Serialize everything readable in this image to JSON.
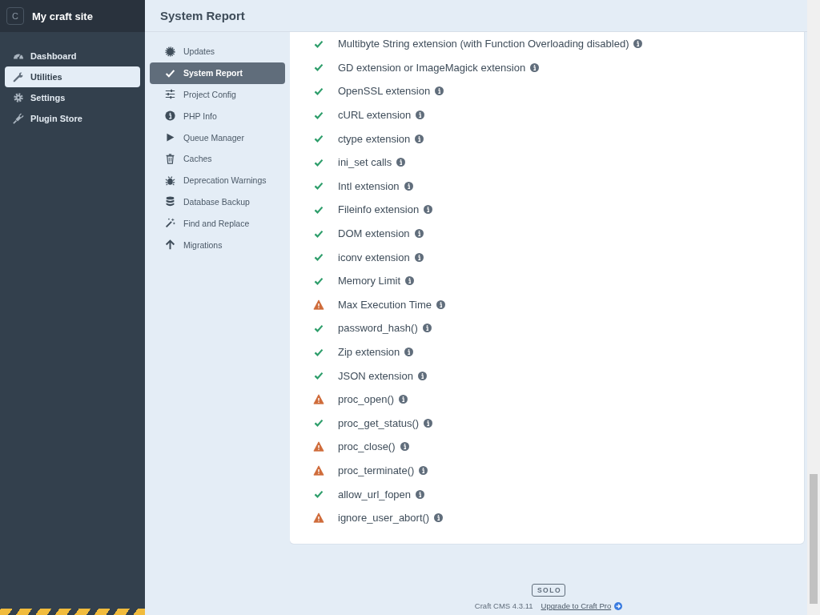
{
  "site": {
    "initial": "C",
    "name": "My craft site"
  },
  "nav": [
    {
      "label": "Dashboard",
      "selected": false
    },
    {
      "label": "Utilities",
      "selected": true
    },
    {
      "label": "Settings",
      "selected": false
    },
    {
      "label": "Plugin Store",
      "selected": false
    }
  ],
  "page_title": "System Report",
  "subnav": [
    {
      "label": "Updates",
      "selected": false
    },
    {
      "label": "System Report",
      "selected": true
    },
    {
      "label": "Project Config",
      "selected": false
    },
    {
      "label": "PHP Info",
      "selected": false
    },
    {
      "label": "Queue Manager",
      "selected": false
    },
    {
      "label": "Caches",
      "selected": false
    },
    {
      "label": "Deprecation Warnings",
      "selected": false
    },
    {
      "label": "Database Backup",
      "selected": false
    },
    {
      "label": "Find and Replace",
      "selected": false
    },
    {
      "label": "Migrations",
      "selected": false
    }
  ],
  "requirements": [
    {
      "name": "Multibyte String extension (with Function Overloading disabled)",
      "kind": "success"
    },
    {
      "name": "GD extension or ImageMagick extension",
      "kind": "success"
    },
    {
      "name": "OpenSSL extension",
      "kind": "success"
    },
    {
      "name": "cURL extension",
      "kind": "success"
    },
    {
      "name": "ctype extension",
      "kind": "success"
    },
    {
      "name": "ini_set calls",
      "kind": "success"
    },
    {
      "name": "Intl extension",
      "kind": "success"
    },
    {
      "name": "Fileinfo extension",
      "kind": "success"
    },
    {
      "name": "DOM extension",
      "kind": "success"
    },
    {
      "name": "iconv extension",
      "kind": "success"
    },
    {
      "name": "Memory Limit",
      "kind": "success"
    },
    {
      "name": "Max Execution Time",
      "kind": "warning"
    },
    {
      "name": "password_hash()",
      "kind": "success"
    },
    {
      "name": "Zip extension",
      "kind": "success"
    },
    {
      "name": "JSON extension",
      "kind": "success"
    },
    {
      "name": "proc_open()",
      "kind": "warning"
    },
    {
      "name": "proc_get_status()",
      "kind": "success"
    },
    {
      "name": "proc_close()",
      "kind": "warning"
    },
    {
      "name": "proc_terminate()",
      "kind": "warning"
    },
    {
      "name": "allow_url_fopen",
      "kind": "success"
    },
    {
      "name": "ignore_user_abort()",
      "kind": "warning"
    }
  ],
  "footer": {
    "edition": "SOLO",
    "version": "Craft CMS 4.3.11",
    "upgrade_link": "Upgrade to Craft Pro"
  }
}
